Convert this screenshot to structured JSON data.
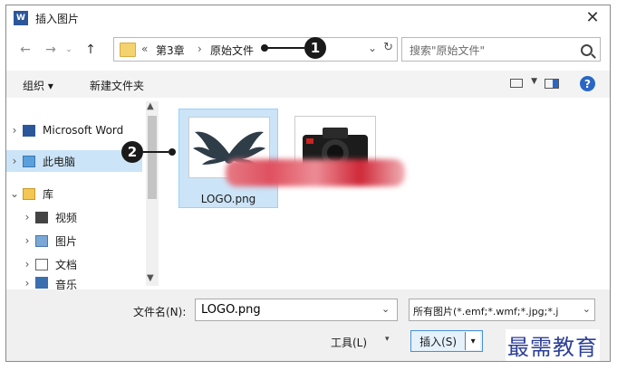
{
  "window": {
    "title": "插入图片",
    "app_icon": "word-icon",
    "close_glyph": "✕"
  },
  "address": {
    "prefix": "«",
    "crumbs": [
      "第3章",
      "原始文件"
    ],
    "separator": "›",
    "dropdown_glyph": "⌄",
    "refresh_glyph": "↻"
  },
  "search": {
    "placeholder": "搜索\"原始文件\""
  },
  "toolbar": {
    "organize": "组织 ▾",
    "new_folder": "新建文件夹",
    "help": "?"
  },
  "sidebar": {
    "items": [
      {
        "label": "Microsoft Word",
        "icon": "word-icon",
        "chevron": "›"
      },
      {
        "label": "此电脑",
        "icon": "computer-icon",
        "chevron": "›",
        "selected": true
      },
      {
        "label": "库",
        "icon": "library-icon",
        "chevron": "⌄"
      },
      {
        "label": "视频",
        "icon": "video-icon",
        "chevron": "›"
      },
      {
        "label": "图片",
        "icon": "pictures-icon",
        "chevron": "›"
      },
      {
        "label": "文档",
        "icon": "documents-icon",
        "chevron": "›"
      },
      {
        "label": "音乐",
        "icon": "music-icon",
        "chevron": "›"
      }
    ]
  },
  "files": [
    {
      "name": "LOGO.png",
      "thumbnail": "logo-thumbnail",
      "selected": true
    },
    {
      "name": "",
      "thumbnail": "camera-thumbnail",
      "selected": false
    }
  ],
  "bottom": {
    "filename_label": "文件名(N):",
    "filename_value": "LOGO.png",
    "filter_value": "所有图片(*.emf;*.wmf;*.jpg;*.j",
    "tools_label": "工具(L)",
    "insert_label": "插入(S)",
    "dropdown_glyph": "▾"
  },
  "annotations": [
    "1",
    "2"
  ],
  "watermark": "最需教育",
  "colors": {
    "selection": "#cce4f7",
    "accent": "#2a67c4",
    "word_blue": "#2b579a"
  }
}
